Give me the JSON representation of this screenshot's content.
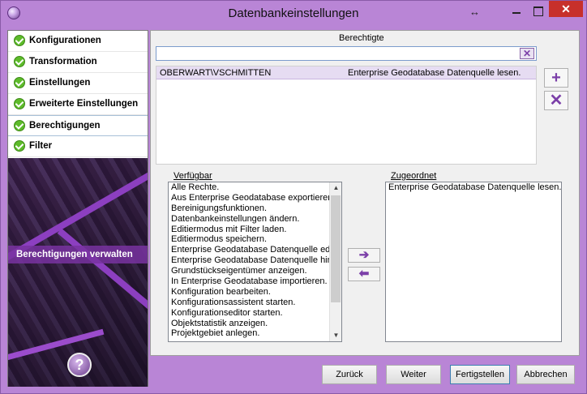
{
  "window": {
    "title": "Datenbankeinstellungen",
    "close_glyph": "✕",
    "resize_glyph": "↔"
  },
  "sidebar": {
    "items": [
      {
        "label": "Konfigurationen",
        "icon": "check-icon"
      },
      {
        "label": "Transformation",
        "icon": "check-icon"
      },
      {
        "label": "Einstellungen",
        "icon": "check-icon"
      },
      {
        "label": "Erweiterte Einstellungen",
        "icon": "check-icon"
      },
      {
        "label": "Berechtigungen",
        "icon": "check-icon",
        "active": true
      },
      {
        "label": "Filter",
        "icon": "check-icon"
      }
    ],
    "caption": "Berechtigungen verwalten",
    "help_glyph": "?"
  },
  "main": {
    "berechtigte_label": "Berechtigte",
    "filter": {
      "value": "",
      "placeholder": ""
    },
    "clear_glyph": "✕",
    "grants": [
      {
        "user": "OBERWART\\VSCHMITTEN",
        "permission": "Enterprise Geodatabase Datenquelle lesen."
      }
    ],
    "add_glyph": "+",
    "remove_glyph": "✕",
    "available_label": "Verfügbar",
    "available": [
      "Alle Rechte.",
      "Aus Enterprise Geodatabase exportieren.",
      "Bereinigungsfunktionen.",
      "Datenbankeinstellungen ändern.",
      "Editiermodus mit Filter laden.",
      "Editiermodus speichern.",
      "Enterprise Geodatabase Datenquelle editieren.",
      "Enterprise Geodatabase Datenquelle hinzufügen.",
      "Grundstückseigentümer anzeigen.",
      "In Enterprise Geodatabase importieren.",
      "Konfiguration bearbeiten.",
      "Konfigurationsassistent starten.",
      "Konfigurationseditor starten.",
      "Objektstatistik anzeigen.",
      "Projektgebiet anlegen."
    ],
    "assigned_label": "Zugeordnet",
    "assigned": [
      "Enterprise Geodatabase Datenquelle lesen."
    ],
    "move_right_glyph": "➔",
    "move_left_glyph": "⬅"
  },
  "footer": {
    "back": "Zurück",
    "next": "Weiter",
    "finish": "Fertigstellen",
    "cancel": "Abbrechen"
  },
  "colors": {
    "accent": "#7b3fa8",
    "title_bar": "#b985d6",
    "close": "#c7302b",
    "check": "#5dbb2a"
  }
}
